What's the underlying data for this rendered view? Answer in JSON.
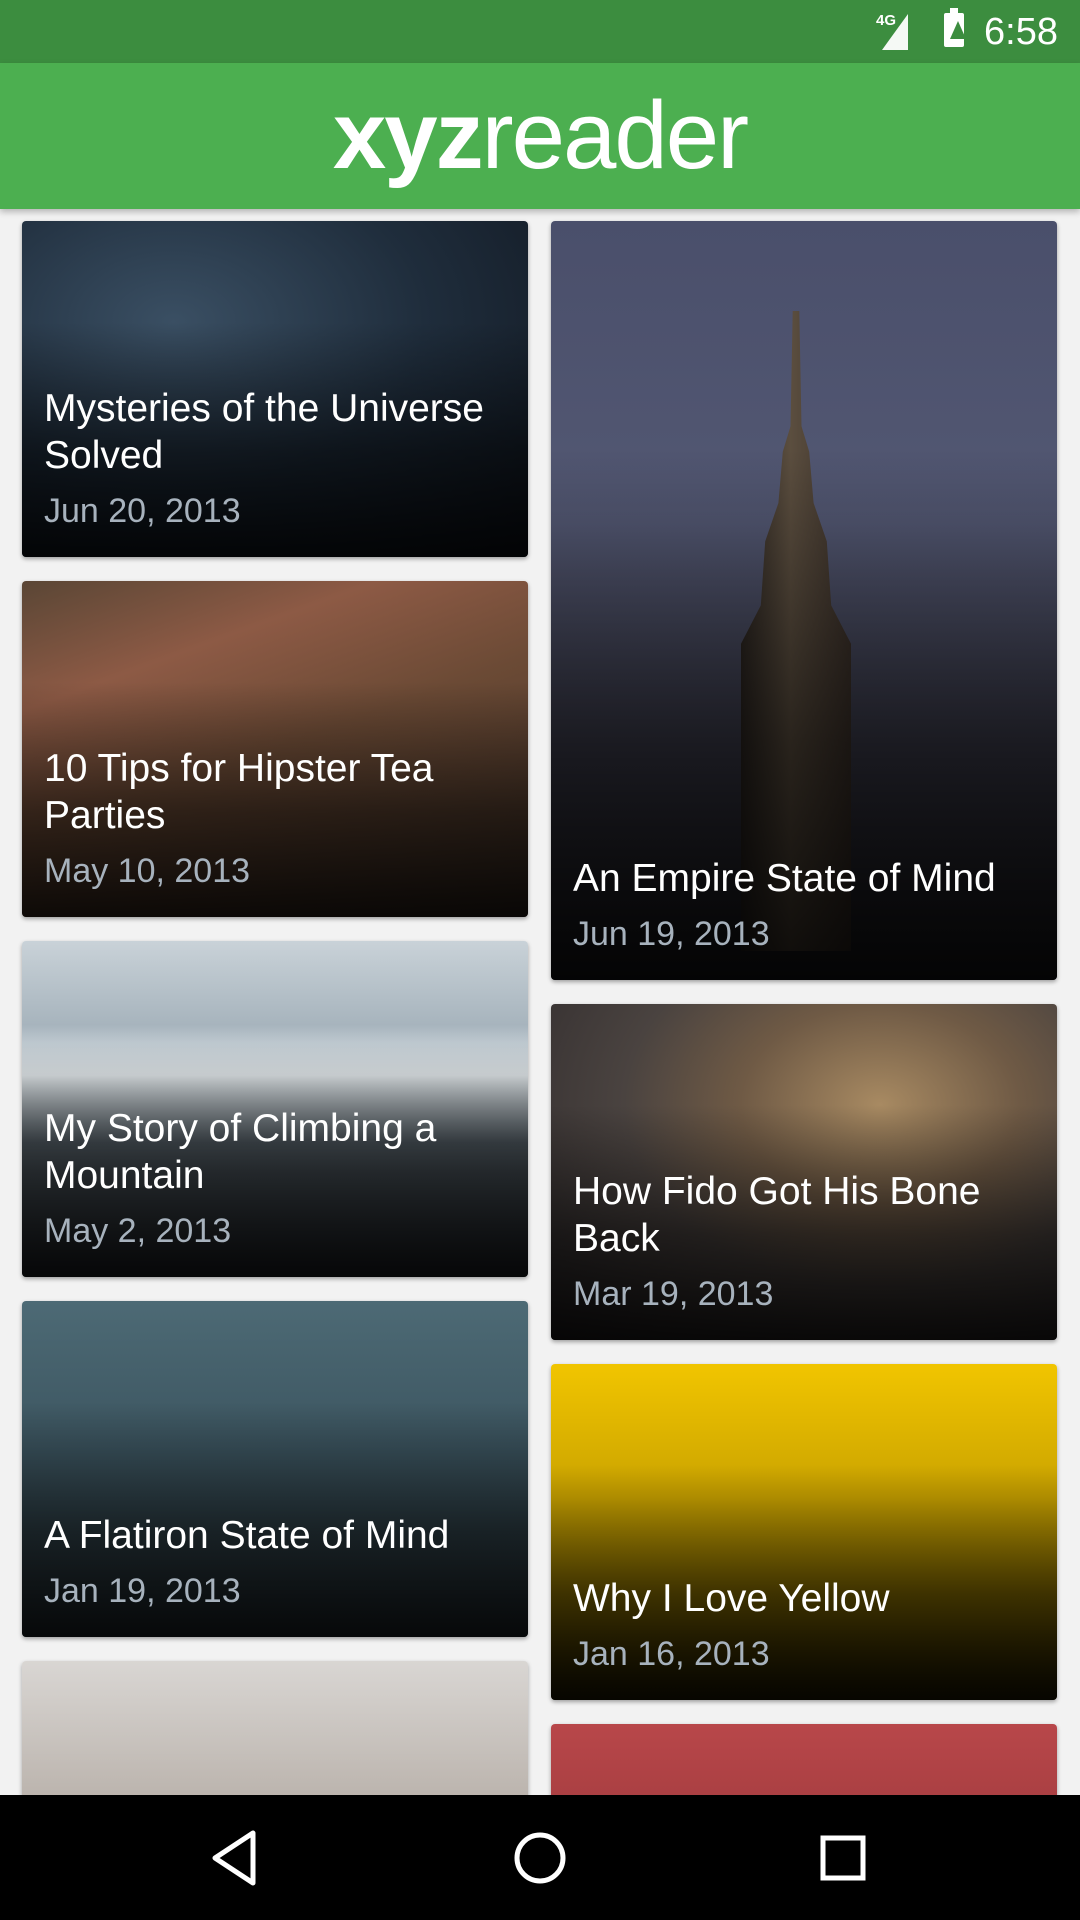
{
  "status_bar": {
    "network": "4G",
    "time": "6:58",
    "icons": [
      "signal-icon",
      "battery-charging-icon"
    ]
  },
  "app_bar": {
    "logo_bold": "xyz",
    "logo_light": "reader",
    "color": "#4caf50"
  },
  "articles": [
    {
      "title": "Mysteries of the Universe Solved",
      "date": "Jun 20, 2013"
    },
    {
      "title": "10 Tips for Hipster Tea Parties",
      "date": "May 10, 2013"
    },
    {
      "title": "My Story of Climbing a Mountain",
      "date": "May 2, 2013"
    },
    {
      "title": "A Flatiron State of Mind",
      "date": "Jan 19, 2013"
    },
    {
      "title": "An Empire State of Mind",
      "date": "Jun 19, 2013"
    },
    {
      "title": "How Fido Got His Bone Back",
      "date": "Mar 19, 2013"
    },
    {
      "title": "Why I Love Yellow",
      "date": "Jan 16, 2013"
    }
  ],
  "nav_bar": {
    "icons": [
      "back-icon",
      "home-icon",
      "recents-icon"
    ]
  }
}
